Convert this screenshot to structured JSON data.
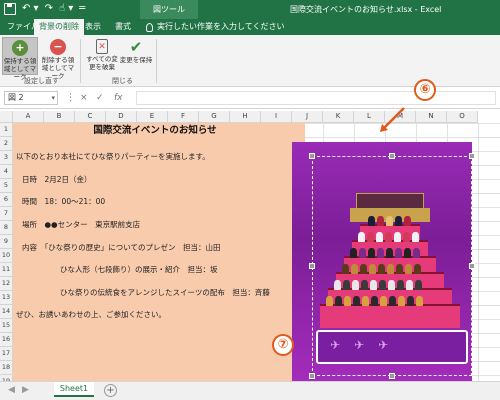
{
  "titlebar": {
    "context_tool": "図ツール",
    "document_title": "国際交流イベントのお知らせ.xlsx  -  Excel",
    "accent": "#217346"
  },
  "tabs": [
    {
      "label": "ファイル"
    },
    {
      "label": "背景の削除"
    },
    {
      "label": "表示"
    },
    {
      "label": "書式"
    }
  ],
  "tell_me": "実行したい作業を入力してください",
  "ribbon": {
    "buttons": [
      {
        "label": "保持する領域としてマーク",
        "icon": "plus-icon"
      },
      {
        "label": "削除する領域としてマーク",
        "icon": "minus-icon"
      },
      {
        "label": "すべての変更を破棄",
        "icon": "discard-icon"
      },
      {
        "label": "変更を保持",
        "icon": "check-icon"
      }
    ],
    "groups": [
      "設定し直す",
      "閉じる"
    ]
  },
  "formula_bar": {
    "namebox": "図 2",
    "cancel": "×",
    "enter": "✓",
    "fx": "fx"
  },
  "columns": [
    "A",
    "B",
    "C",
    "D",
    "E",
    "F",
    "G",
    "H",
    "I",
    "J",
    "K",
    "L",
    "M",
    "N",
    "O"
  ],
  "rows": [
    "1",
    "2",
    "3",
    "4",
    "5",
    "6",
    "7",
    "8",
    "9",
    "10",
    "11",
    "12",
    "13",
    "14",
    "15",
    "16",
    "17",
    "18",
    "19",
    "20",
    "21",
    "22"
  ],
  "document": {
    "title": "国際交流イベントのお知らせ",
    "lines": [
      "以下のとおり本社にてひな祭りパーティーを実施します。",
      "日時　2月2日（金）",
      "時間　18：00～21：00",
      "場所　●●センター　東京駅前支店",
      "内容　「ひな祭りの歴史」についてのプレゼン　担当：山田",
      "ひな人形（七段飾り）の展示・紹介　担当：坂",
      "ひな祭りの伝統食をアレンジしたスイーツの配布　担当：斉藤",
      "ぜひ、お誘いあわせの上、ご参加ください。"
    ],
    "highlight_color": "#f8cbad"
  },
  "annotations": [
    {
      "label": "⑥"
    },
    {
      "label": "⑦"
    }
  ],
  "sheets": [
    {
      "name": "Sheet1",
      "active": true
    }
  ]
}
